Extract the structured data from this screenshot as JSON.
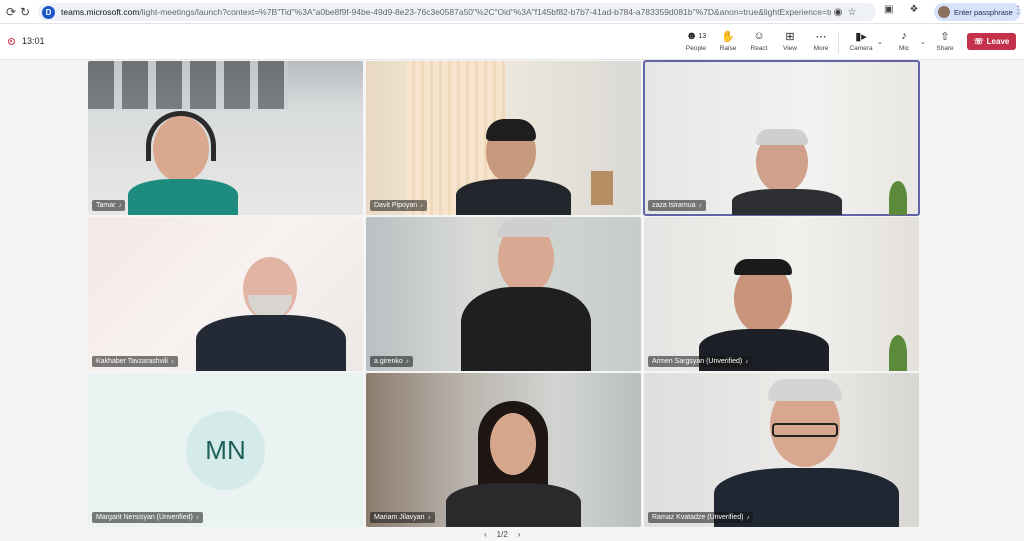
{
  "browser": {
    "url_host": "teams.microsoft.com",
    "url_path": "/light-meetings/launch?context=%7B\"Tid\"%3A\"a0be8f9f-94be-49d9-8e23-76c3e0587a50\"%2C\"Oid\"%3A\"f145bf82-b7b7-41ad-b784-a783359d081b\"%7D&anon=true&lightExperience=true&correlationId=...",
    "passphrase_label": "Enter passphrase"
  },
  "toolbar": {
    "meeting_time": "13:01",
    "people_label": "People",
    "people_count": "13",
    "raise_label": "Raise",
    "react_label": "React",
    "view_label": "View",
    "more_label": "More",
    "camera_label": "Camera",
    "mic_label": "Mic",
    "share_label": "Share",
    "leave_label": "Leave"
  },
  "participants": [
    {
      "name": "Tamar"
    },
    {
      "name": "Davit Pipoyan"
    },
    {
      "name": "zaza tsiramua"
    },
    {
      "name": "Kakhaber Tavzarashvili"
    },
    {
      "name": "a.girenko"
    },
    {
      "name": "Armen Sargsyan (Unverified)"
    },
    {
      "name": "Margarit Nersisyan (Unverified)",
      "initials": "MN"
    },
    {
      "name": "Mariam Jilavyan"
    },
    {
      "name": "Ramaz Kvatadze (Unverified)"
    }
  ],
  "pager": {
    "page": "1/2"
  },
  "colors": {
    "leave": "#c4314b",
    "active_outline": "#6264a7",
    "avatar_bg": "#d4ebe9"
  }
}
